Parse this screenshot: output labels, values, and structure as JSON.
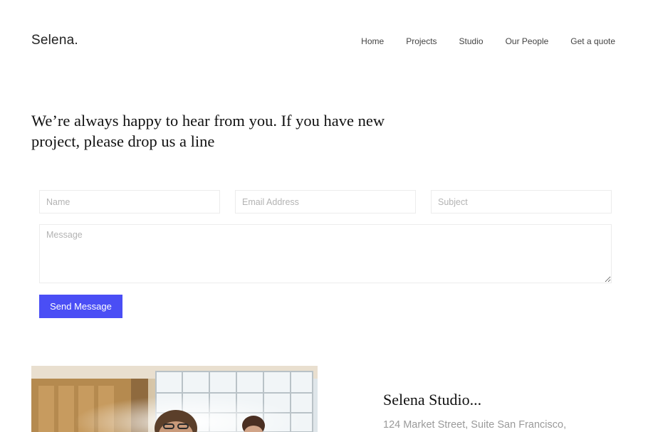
{
  "header": {
    "logo": "Selena.",
    "nav": [
      "Home",
      "Projects",
      "Studio",
      "Our People",
      "Get a quote"
    ]
  },
  "contact": {
    "headline": "We’re always happy to hear from you. If you have new project, please drop us a line",
    "name_placeholder": "Name",
    "email_placeholder": "Email Address",
    "subject_placeholder": "Subject",
    "message_placeholder": "Message",
    "send_label": "Send Message",
    "accent_color": "#4a4ef5"
  },
  "studio": {
    "title": "Selena Studio...",
    "address": "124 Market Street, Suite San Francisco,"
  }
}
